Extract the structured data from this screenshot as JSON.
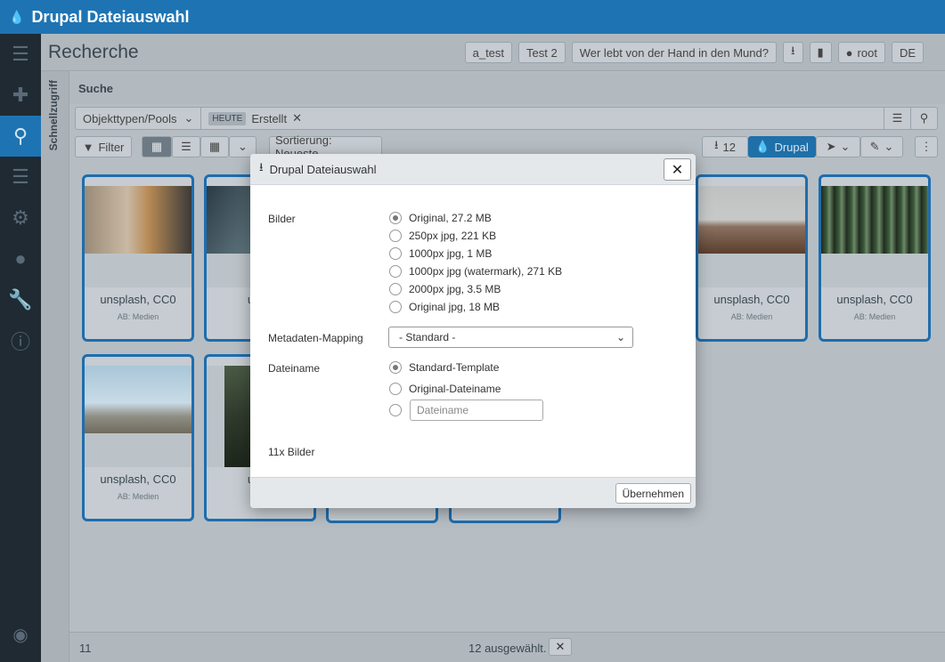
{
  "app": {
    "title": "Drupal Dateiauswahl",
    "logo_icon": "drupal-icon"
  },
  "sidebar": {
    "icons": [
      "menu-icon",
      "plus-icon",
      "search-icon",
      "list-icon",
      "settings-icon",
      "users-icon",
      "wrench-icon",
      "info-icon"
    ],
    "quick_access_label": "Schnellzugriff"
  },
  "header": {
    "page_title": "Recherche",
    "buttons": [
      "a_test",
      "Test 2",
      "Wer lebt von der Hand in den Mund?"
    ],
    "user": "root",
    "language": "DE"
  },
  "search": {
    "heading": "Suche",
    "object_types": "Objekttypen/Pools",
    "chip_tag": "HEUTE",
    "chip_label": "Erstellt"
  },
  "toolbar": {
    "filter": "Filter",
    "sort": "Sortierung: Neueste",
    "download_count": "12",
    "drupal": "Drupal"
  },
  "cards": [
    {
      "caption": "unsplash, CC0",
      "sub": "AB: Medien"
    },
    {
      "caption": "unsp",
      "sub": "AB"
    },
    {
      "caption": "unsplash, CC0",
      "sub": "AB: Medien"
    },
    {
      "caption": "unsplash, CC0",
      "sub": "AB: Medien"
    },
    {
      "caption": "unsplash, CC0",
      "sub": "AB: Medien"
    },
    {
      "caption": "unsp",
      "sub": "AB"
    }
  ],
  "status": {
    "count": "11",
    "selected": "12 ausgewählt."
  },
  "modal": {
    "title": "Drupal Dateiauswahl",
    "images_label": "Bilder",
    "image_options": [
      "Original, 27.2 MB",
      "250px jpg, 221 KB",
      "1000px jpg, 1 MB",
      "1000px jpg (watermark), 271 KB",
      "2000px jpg, 3.5 MB",
      "Original jpg, 18 MB"
    ],
    "mapping_label": "Metadaten-Mapping",
    "mapping_value": "- Standard -",
    "filename_label": "Dateiname",
    "filename_options": [
      "Standard-Template",
      "Original-Dateiname"
    ],
    "filename_placeholder": "Dateiname",
    "count_text": "11x Bilder",
    "apply": "Übernehmen"
  }
}
